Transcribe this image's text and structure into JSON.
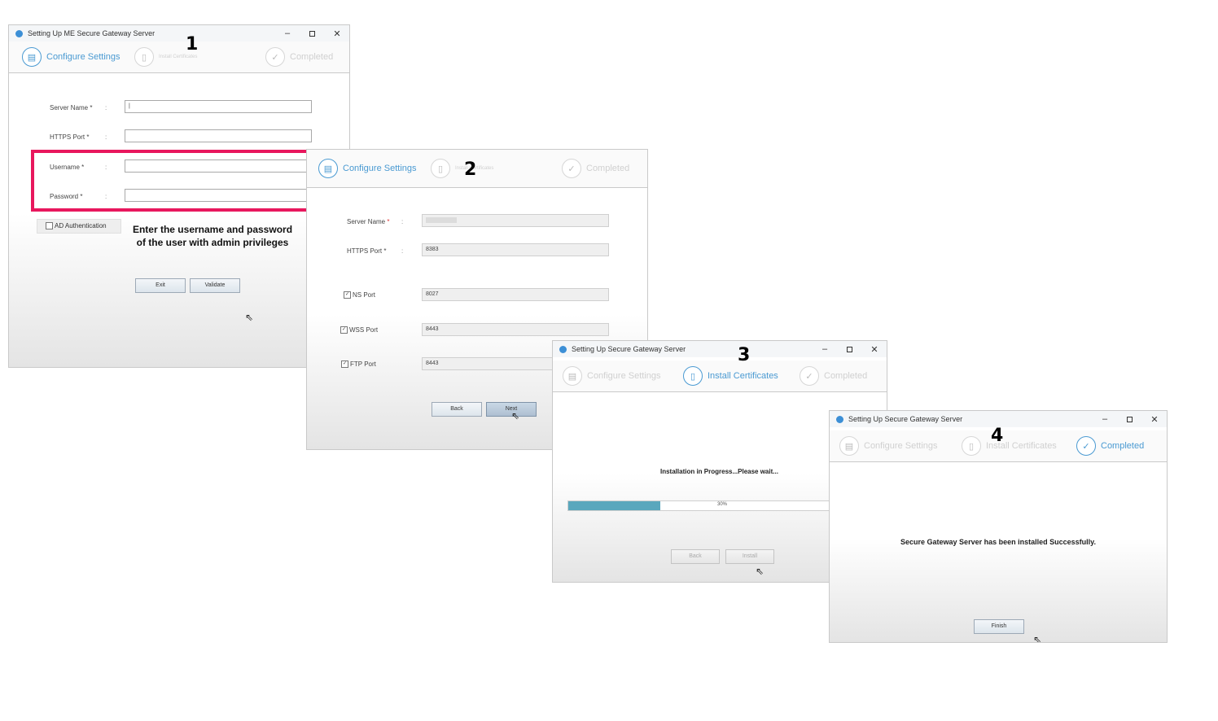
{
  "step_numbers": [
    "1",
    "2",
    "3",
    "4"
  ],
  "window1": {
    "title": "Setting Up ME Secure Gateway Server",
    "steps": [
      "Configure Settings",
      "Install Certificates",
      "Completed"
    ],
    "fields": {
      "server_name_label": "Server Name",
      "https_port_label": "HTTPS Port",
      "username_label": "Username",
      "password_label": "Password",
      "server_name_value": "|"
    },
    "ad_auth_label": "AD Authentication",
    "exit_label": "Exit",
    "validate_label": "Validate"
  },
  "annotation": {
    "text": "Enter the  username and password of the user with admin privileges",
    "highlight_color": "#e8175d"
  },
  "window2": {
    "steps": [
      "Configure Settings",
      "Install Certificates",
      "Completed"
    ],
    "server_name_label": "Server Name",
    "https_port_label": "HTTPS Port",
    "https_port_value": "8383",
    "ns_port_label": "NS Port",
    "ns_port_value": "8027",
    "wss_port_label": "WSS Port",
    "wss_port_value": "8443",
    "ftp_port_label": "FTP Port",
    "ftp_port_value": "8443",
    "back_label": "Back",
    "next_label": "Next"
  },
  "window3": {
    "title": "Setting Up Secure Gateway Server",
    "steps": [
      "Configure Settings",
      "Install Certificates",
      "Completed"
    ],
    "progress_text": "Installation in Progress...Please wait...",
    "progress_percent": 30,
    "progress_label": "30%",
    "back_label": "Back",
    "install_label": "Install"
  },
  "window4": {
    "title": "Setting Up Secure Gateway Server",
    "steps": [
      "Configure Settings",
      "Install Certificates",
      "Completed"
    ],
    "success_text": "Secure Gateway Server has been installed Successfully.",
    "finish_label": "Finish"
  },
  "colors": {
    "accent": "#4a9ad2",
    "progress_fill": "#5aa7bd",
    "highlight": "#e8175d"
  }
}
